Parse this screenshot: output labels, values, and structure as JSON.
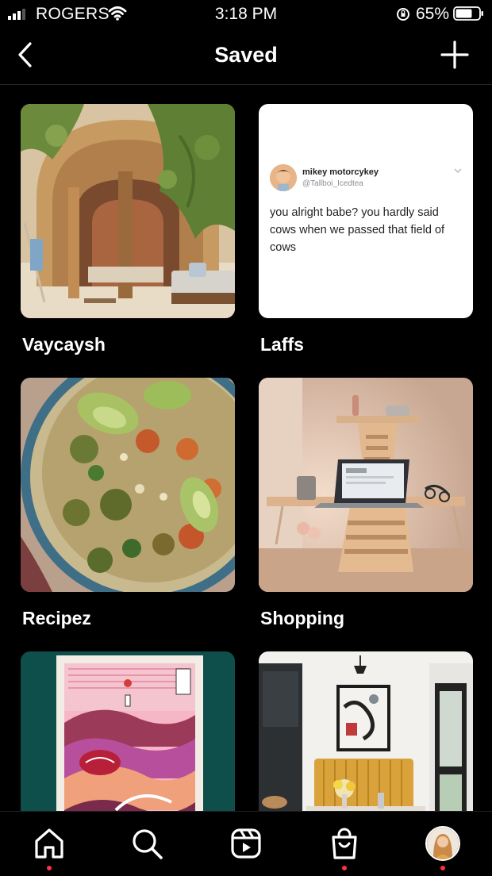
{
  "status_bar": {
    "carrier": "ROGERS",
    "time": "3:18 PM",
    "battery_percent": "65%"
  },
  "header": {
    "title": "Saved"
  },
  "collections": [
    {
      "name": "Vaycaysh"
    },
    {
      "name": "Laffs"
    },
    {
      "name": "Recipez"
    },
    {
      "name": "Shopping"
    },
    {
      "name": ""
    },
    {
      "name": ""
    }
  ],
  "tweet": {
    "author": "mikey motorcykey",
    "handle": "@Tallboi_Icedtea",
    "text": "you alright babe? you hardly said cows when we passed that field of cows"
  },
  "colors": {
    "background": "#000000",
    "notification_dot": "#ff3040"
  },
  "bottom_nav": {
    "items": [
      "home-icon",
      "search-icon",
      "reels-icon",
      "shop-icon",
      "profile-avatar"
    ]
  }
}
